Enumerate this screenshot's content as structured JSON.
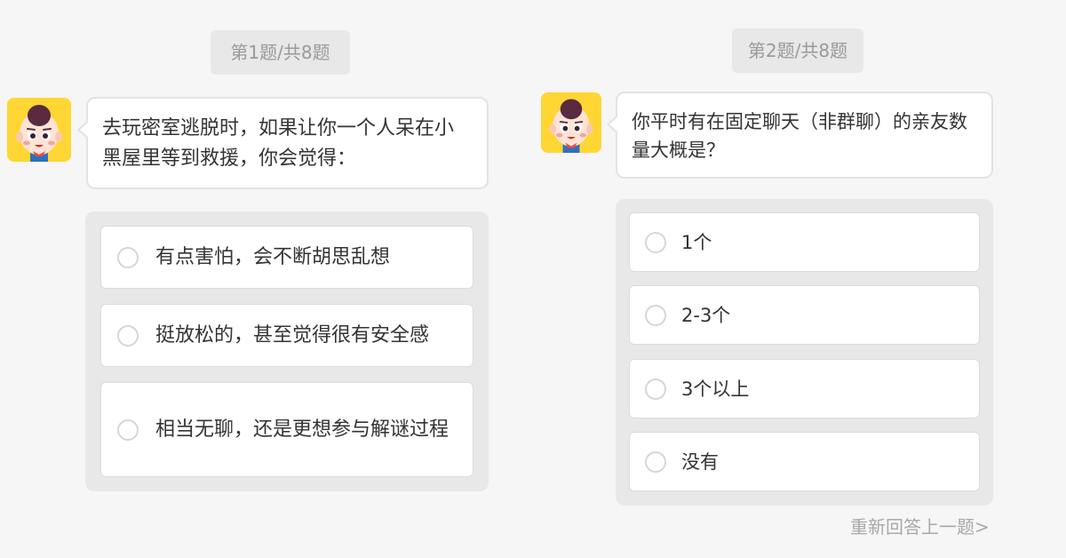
{
  "question1": {
    "counter": "第1题/共8题",
    "text": "去玩密室逃脱时，如果让你一个人呆在小黑屋里等到救援，你会觉得：",
    "options": [
      {
        "label": "有点害怕，会不断胡思乱想"
      },
      {
        "label": "挺放松的，甚至觉得很有安全感"
      },
      {
        "label": "相当无聊，还是更想参与解谜过程"
      }
    ]
  },
  "question2": {
    "counter": "第2题/共8题",
    "text": "你平时有在固定聊天（非群聊）的亲友数量大概是？",
    "options": [
      {
        "label": "1个"
      },
      {
        "label": "2-3个"
      },
      {
        "label": "3个以上"
      },
      {
        "label": "没有"
      }
    ]
  },
  "footer": {
    "redo_label": "重新回答上一题>"
  },
  "colors": {
    "background": "#f6f6f6",
    "panel": "#e8e8e8",
    "avatar_bg": "#ffd633",
    "muted_text": "#999999"
  },
  "icons": {
    "avatar": "cartoon-boy-avatar-icon",
    "radio": "radio-unchecked-icon"
  }
}
